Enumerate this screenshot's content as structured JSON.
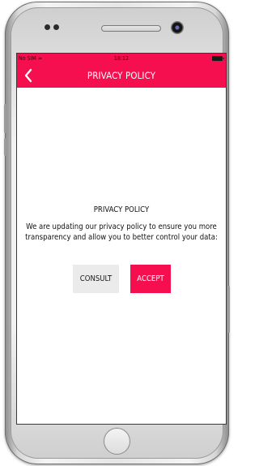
{
  "status_bar": {
    "carrier": "No SIM",
    "time": "18:12"
  },
  "header": {
    "title": "PRIVACY POLICY",
    "back_icon": "chevron-left-icon"
  },
  "content": {
    "heading": "PRIVACY POLICY",
    "body": "We are updating our privacy policy to ensure you more transparency and allow you to better control your data:",
    "consult_label": "CONSULT",
    "accept_label": "ACCEPT"
  },
  "colors": {
    "accent": "#f50f4f",
    "secondary_button": "#ebebeb"
  }
}
